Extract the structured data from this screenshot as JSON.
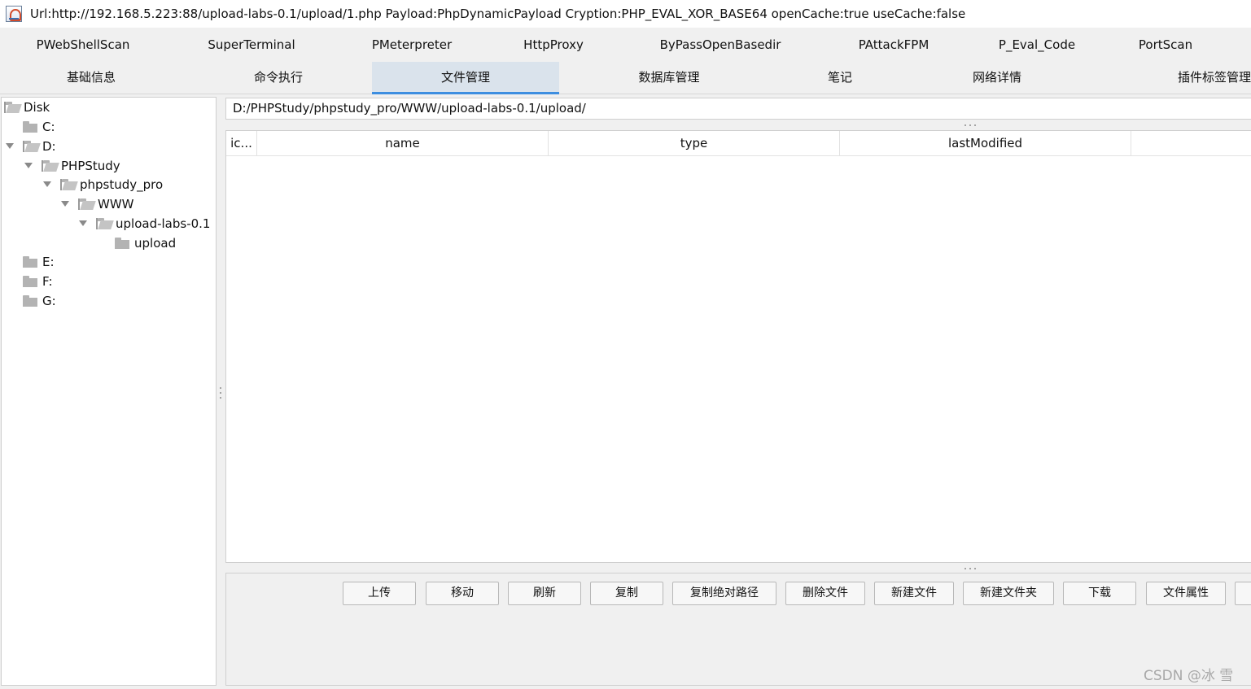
{
  "window": {
    "title": "Url:http://192.168.5.223:88/upload-labs-0.1/upload/1.php Payload:PhpDynamicPayload Cryption:PHP_EVAL_XOR_BASE64 openCache:true useCache:false",
    "icon": "java-app-icon"
  },
  "plugin_tabs": [
    "PWebShellScan",
    "SuperTerminal",
    "PMeterpreter",
    "HttpProxy",
    "ByPassOpenBasedir",
    "PAttackFPM",
    "P_Eval_Code",
    "PortScan"
  ],
  "main_tabs": [
    "基础信息",
    "命令执行",
    "文件管理",
    "数据库管理",
    "笔记",
    "网络详情",
    "插件标签管理"
  ],
  "active_main_tab": "文件管理",
  "tree": {
    "root": "Disk",
    "nodes": [
      "C:",
      "D:",
      "PHPStudy",
      "phpstudy_pro",
      "WWW",
      "upload-labs-0.1",
      "upload",
      "E:",
      "F:",
      "G:"
    ]
  },
  "path": "D:/PHPStudy/phpstudy_pro/WWW/upload-labs-0.1/upload/",
  "table": {
    "columns": [
      "ic...",
      "name",
      "type",
      "lastModified"
    ]
  },
  "buttons": [
    "上传",
    "移动",
    "刷新",
    "复制",
    "复制绝对路径",
    "删除文件",
    "新建文件",
    "新建文件夹",
    "下载",
    "文件属性"
  ],
  "watermark": "CSDN @冰 雪",
  "colors": {
    "active_tab_bg": "#dae3ec",
    "active_tab_underline": "#3d8ee0",
    "folder": "#b3b3b3"
  }
}
